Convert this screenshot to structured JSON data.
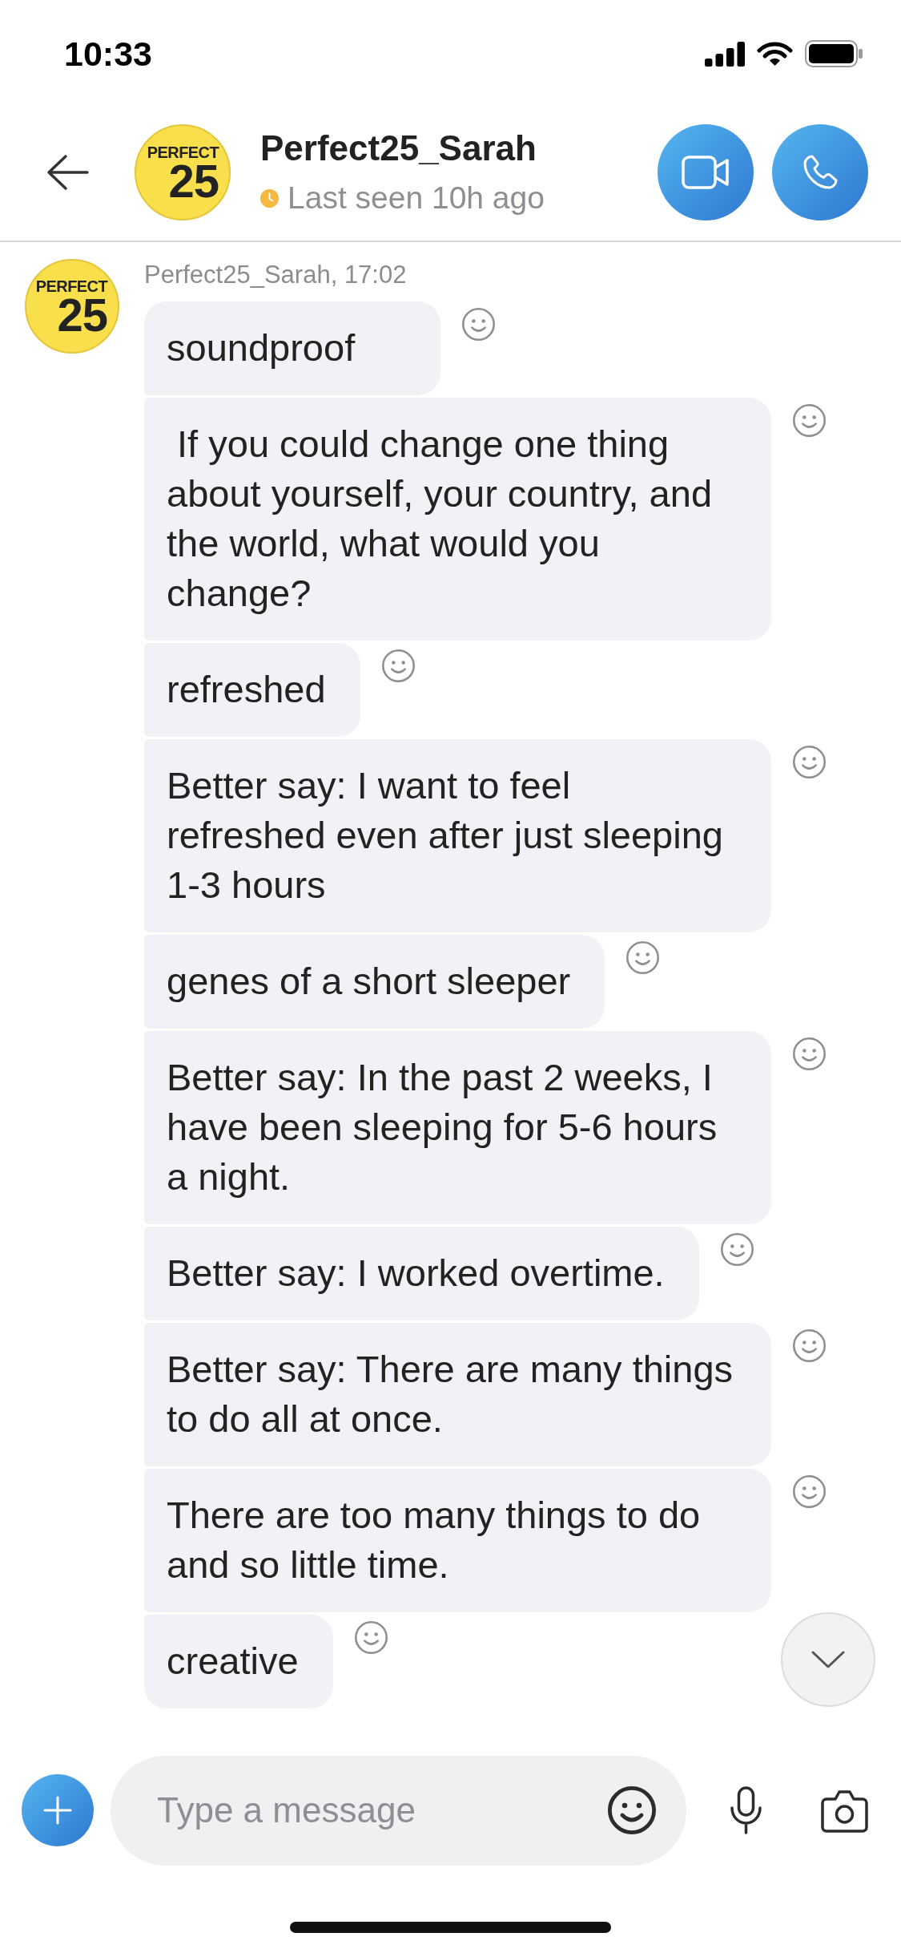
{
  "status_bar": {
    "time": "10:33"
  },
  "header": {
    "avatar": {
      "line_1": "PERFECT",
      "line_2": "25"
    },
    "name": "Perfect25_Sarah",
    "away": true,
    "status": "Last seen 10h ago"
  },
  "message_group": {
    "avatar": {
      "line_1": "PERFECT",
      "line_2": "25"
    },
    "sender_line": "Perfect25_Sarah, 17:02",
    "messages": [
      {
        "text": "soundproof"
      },
      {
        "text": " If you could change one thing about yourself, your country, and the world, what would you change?"
      },
      {
        "text": "refreshed"
      },
      {
        "text": "Better say: I want to feel refreshed even after just sleeping 1-3 hours"
      },
      {
        "text": "genes of a short sleeper"
      },
      {
        "text": "Better say: In the past 2 weeks, I have been sleeping for 5-6 hours a night."
      },
      {
        "text": "Better say: I worked overtime."
      },
      {
        "text": "Better say: There are many things to do all at once."
      },
      {
        "text": "There are too many things to do and so little time."
      },
      {
        "text": "creative"
      }
    ]
  },
  "composer": {
    "placeholder": "Type a message"
  }
}
